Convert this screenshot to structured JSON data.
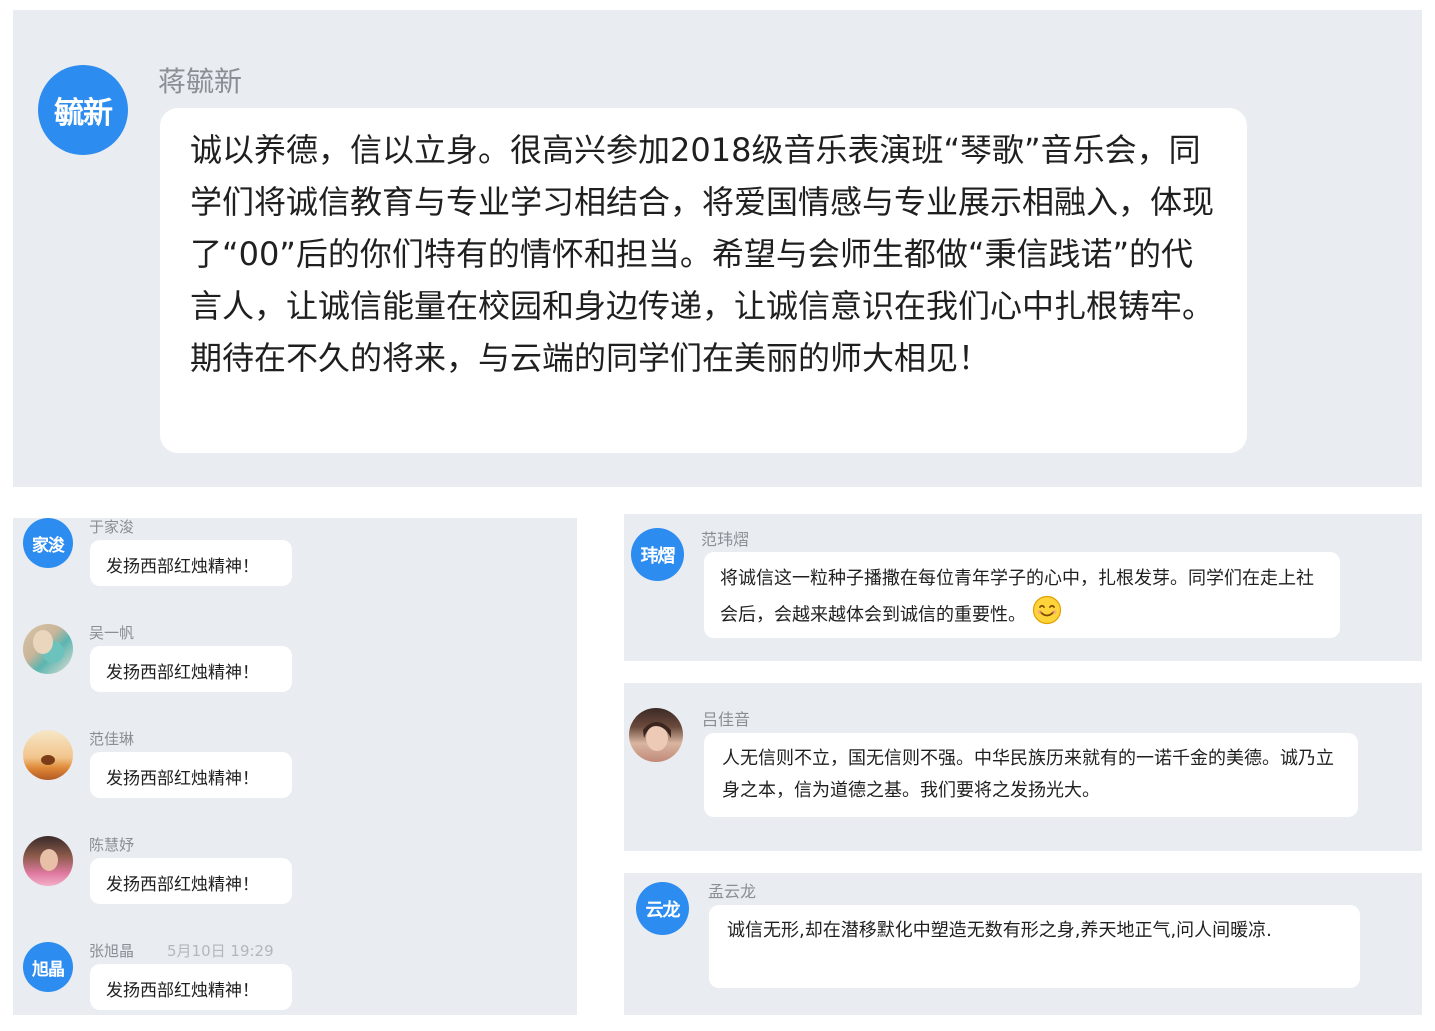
{
  "main_post": {
    "avatar_text": "毓新",
    "username": "蒋毓新",
    "message": "诚以养德，信以立身。很高兴参加2018级音乐表演班“琴歌”音乐会，同学们将诚信教育与专业学习相结合，将爱国情感与专业展示相融入，体现了“00”后的你们特有的情怀和担当。希望与会师生都做“秉信践诺”的代言人，让诚信能量在校园和身边传递，让诚信意识在我们心中扎根铸牢。期待在不久的将来，与云端的同学们在美丽的师大相见！"
  },
  "left_comments": [
    {
      "avatar_text": "家浚",
      "avatar_type": "text",
      "username": "于家浚",
      "timestamp": "",
      "message": "发扬西部红烛精神！"
    },
    {
      "avatar_text": "",
      "avatar_type": "photo-masked-person",
      "username": "吴一帆",
      "timestamp": "",
      "message": "发扬西部红烛精神！"
    },
    {
      "avatar_text": "",
      "avatar_type": "photo-sunset-cat",
      "username": "范佳琳",
      "timestamp": "",
      "message": "发扬西部红烛精神！"
    },
    {
      "avatar_text": "",
      "avatar_type": "photo-portrait",
      "username": "陈慧妤",
      "timestamp": "",
      "message": "发扬西部红烛精神！"
    },
    {
      "avatar_text": "旭晶",
      "avatar_type": "text",
      "username": "张旭晶",
      "timestamp": "5月10日 19:29",
      "message": "发扬西部红烛精神！"
    }
  ],
  "right_comments": [
    {
      "avatar_text": "玮熠",
      "avatar_type": "text",
      "username": "范玮熠",
      "message": "将诚信这一粒种子播撒在每位青年学子的心中，扎根发芽。同学们在走上社会后，会越来越体会到诚信的重要性。",
      "emoji": "smile-emoji-icon"
    },
    {
      "avatar_text": "",
      "avatar_type": "photo-girl",
      "username": "吕佳音",
      "message": "人无信则不立，国无信则不强。中华民族历来就有的一诺千金的美德。诚乃立身之本，信为道德之基。我们要将之发扬光大。"
    },
    {
      "avatar_text": "云龙",
      "avatar_type": "text",
      "username": "孟云龙",
      "message": "诚信无形,却在潜移默化中塑造无数有形之身,养天地正气,问人间暖凉."
    }
  ],
  "colors": {
    "panel_bg": "#e9ecf0",
    "avatar_blue": "#2d8cf0",
    "bubble_bg": "#ffffff",
    "name_gray": "#8a8f96"
  }
}
